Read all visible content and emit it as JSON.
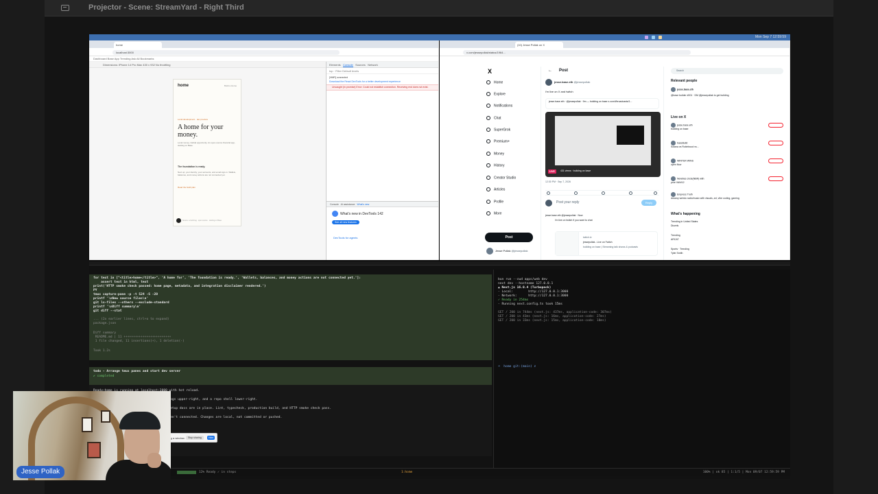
{
  "window": {
    "title": "Projector - Scene: StreamYard - Right Third"
  },
  "menubar": {
    "clock": "Mon Sep 7  12:59:59"
  },
  "left_browser": {
    "tab_title": "home",
    "url": "localhost:3000",
    "bookmarks": "Dashboard    Base App    Trending    Ask                    All Bookmarks",
    "device_toolbar": "Dimensions: iPhone 14 Pro Max    430  x  932    No throttling",
    "page": {
      "brand": "home",
      "signin": "Build a Home",
      "kicker": "Local development · dev preview",
      "headline": "A home for your money.",
      "lede": "Local money. Global opportunity. An open-source financial app, starting on Base.",
      "subhead": "The foundation is ready.",
      "body": "Next up: your identity, your accounts, and email sign-in. Wallets, balances, and money actions are not connected yet.",
      "link": "Read the build plan",
      "footer": "Source: a build log · open source · starting on Base"
    },
    "devtools": {
      "tabs": [
        "Elements",
        "Console",
        "Sources",
        "Network"
      ],
      "active_tab": "Console",
      "filter": "top  ·  Filter                    Default levels",
      "lines": [
        "[HMR] connected",
        "Download the React DevTools for a better development experience"
      ],
      "error": "Uncaught (in promise) Error: Could not establish connection. Receiving end does not exist.",
      "drawer_tabs": [
        "Console",
        "AI assistance",
        "What's new"
      ],
      "drawer_active": "What's new",
      "whats_new": "What's new in DevTools 142",
      "see_all": "See all new features",
      "agents": "DevTools for agents"
    }
  },
  "right_browser": {
    "tab_title": "(10) Jesse Pollak on X",
    "url": "x.com/jessepollak/status/1964...",
    "nav": [
      "Home",
      "Explore",
      "Notifications",
      "Chat",
      "SuperGrok",
      "Premium+",
      "Money",
      "History",
      "Creator Studio",
      "Articles",
      "Profile",
      "More"
    ],
    "post_button": "Post",
    "account_name": "Jesse Pollak",
    "account_handle": "@jessepollak",
    "post": {
      "header": "Post",
      "author": "jesse.base.eth",
      "handle": "@jessepollak",
      "text": "i'm live on X and twitch",
      "quote": "jesse.base.eth · @jessepollak · 9m — building on base x.com/i/broadcasts/1...",
      "live_badge": "LIVE",
      "live_meta": "431 views · building on base",
      "time": "12:30 PM · Sep 7, 2026",
      "reply_placeholder": "Post your reply",
      "reply_button": "Reply",
      "reply_author": "jesse.base.eth @jessepollak · Now",
      "reply_text": "i'm live on twitch if you want to chat",
      "card_domain": "twitch.tv",
      "card_title": "jessepollak - Live on Twitch",
      "card_desc": "building on base | Streaming talk shows & podcasts"
    },
    "search_placeholder": "Search",
    "relevant_people": {
      "title": "Relevant people",
      "name": "jesse.base.eth",
      "bio": "@base builder #001 · DM @jessepollak to get building"
    },
    "live_on_x": {
      "title": "Live on X",
      "items": [
        {
          "host": "jesse.base.eth",
          "topic": "building on base"
        },
        {
          "host": "baseBuild",
          "topic": "Solana vs Robinhood vs..."
        },
        {
          "host": "WINTER WINS",
          "topic": "open floor"
        },
        {
          "host": "Newbies circle(NBR) with",
          "topic": "your VAN/12"
        },
        {
          "host": "Empress Truth",
          "topic": "dreamy weirdo radio/music with visuals, art, vibe coding, gaming"
        }
      ]
    },
    "whats_happening": {
      "title": "What's happening",
      "items": [
        {
          "meta": "Trending in United States",
          "topic": "Dizzels"
        },
        {
          "meta": "Trending",
          "topic": "ARCAT"
        },
        {
          "meta": "Sports · Trending",
          "topic": "Tyler Smith"
        }
      ]
    }
  },
  "terminal": {
    "left_top": [
      "for text in [\"<title>home</title>\", 'A home for', 'The foundation is ready.', 'Wallets, balances, and money actions are not connected yet.']:",
      "    assert text in html, text",
      "print('HTTP smoke check passed: home page, metadata, and integration disclaimer rendered.')",
      "PY",
      "tmux capture-pane -p -t 524 -S -20",
      "printf '\\nNew source files\\n'",
      "git ls-files --others --exclude-standard",
      "printf '\\nDiff summary\\n'",
      "git diff --stat"
    ],
    "left_top_dim": [
      "... (2x earlier lines, ctrl+o to expand)",
      "package.json"
    ],
    "left_diff": [
      "Diff summary",
      " README.md | 11 +++++++++++++++++++++++++",
      " 1 file changed, 11 insertions(+), 1 deletion(-)"
    ],
    "left_tok": "Took 1.2s",
    "left_todo": "todo - Arrange tmux panes and start dev server",
    "left_completed": "✔ completed",
    "left_bottom": [
      "Ready—home is running at localhost:3000 with hot reload.",
      "...left, dev-server logs upper-right, and a repo shell lower-right.",
      "...n workspace, and setup docs are in place. Lint, typecheck, production build, and HTTP smoke check pass.",
      "...ot integrations aren't connected. Changes are local, not committed or pushed."
    ],
    "right_top": [
      "bun run --cwd apps/web dev",
      "next dev --hostname 127.0.0.1",
      "▲ Next.js 16.0.4 (Turbopack)",
      "- Local:        http://127.0.0.1:3000",
      "- Network:      http://127.0.0.1:3000",
      "✓ Ready in 254ms",
      "- Running next.config.ts took 15ms",
      "",
      "GET / 200 in 744ms (next.js: 437ms, application-code: 307ms)",
      "GET / 200 in 43ms (next.js: 16ms, application-code: 27ms)",
      "GET / 200 in 33ms (next.js: 15ms, application-code: 18ms)"
    ],
    "right_prompt": "➜  home git:(main) ✗",
    "status_left": "12% Ready ✓ in steps",
    "status_mid": "1:home",
    "status_right": "100% | ok 85 | 1:1/5 | Mon 09/07 12:59:59 PM"
  },
  "share_bar": {
    "text": "streamyard.com is sharing a window.",
    "stop": "Stop sharing",
    "hide": "Hide"
  },
  "webcam": {
    "name": "Jesse Pollak"
  }
}
